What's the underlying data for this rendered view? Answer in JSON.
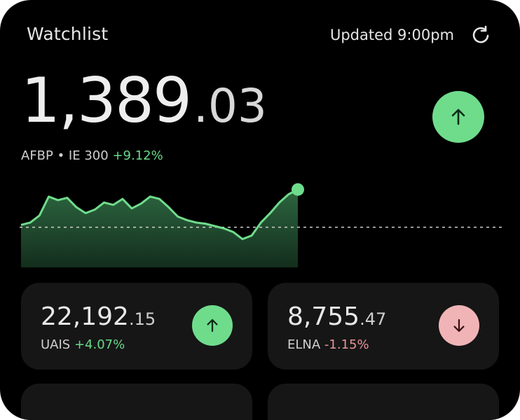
{
  "header": {
    "title": "Watchlist",
    "updated": "Updated 9:00pm",
    "refresh_icon": "refresh-icon"
  },
  "main_quote": {
    "price_int": "1,389",
    "price_dec": ".03",
    "symbol_line": "AFBP • IE 300",
    "change": "+9.12%",
    "direction": "up",
    "up_color": "#6fdc8c"
  },
  "chart_data": {
    "type": "area",
    "series": [
      {
        "values": [
          36,
          38,
          44,
          60,
          57,
          59,
          51,
          46,
          49,
          55,
          53,
          58,
          50,
          54,
          60,
          58,
          51,
          43,
          40,
          38,
          37,
          35,
          33,
          30,
          24,
          27,
          38,
          46,
          55,
          62,
          66
        ]
      }
    ],
    "baseline": 34,
    "ylim": [
      0,
      70
    ],
    "line_color": "#6fdc8c",
    "grid": false
  },
  "tiles": [
    {
      "price_int": "22,192",
      "price_dec": ".15",
      "symbol": "UAIS",
      "change": "+4.07%",
      "direction": "up",
      "button_color": "#6fdc8c"
    },
    {
      "price_int": "8,755",
      "price_dec": ".47",
      "symbol": "ELNA",
      "change": "-1.15%",
      "direction": "down",
      "button_color": "#f0b4b7"
    }
  ]
}
